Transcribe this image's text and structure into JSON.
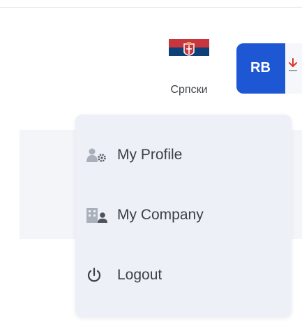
{
  "language": {
    "label": "Српски",
    "flag_colors": [
      "#c6363c",
      "#0c4076",
      "#ffffff"
    ]
  },
  "user": {
    "initials": "RB",
    "button_color": "#1e57d4"
  },
  "download_icon": {
    "name": "download-arrow-icon",
    "color": "#e0352b"
  },
  "menu": {
    "items": [
      {
        "label": "My Profile",
        "icon": "user-settings-icon"
      },
      {
        "label": "My Company",
        "icon": "company-building-icon"
      },
      {
        "label": "Logout",
        "icon": "power-icon"
      }
    ]
  },
  "colors": {
    "menu_bg": "#eef0f8",
    "panel_bg": "#f4f5f8",
    "icon_gray": "#9aa1ad"
  }
}
